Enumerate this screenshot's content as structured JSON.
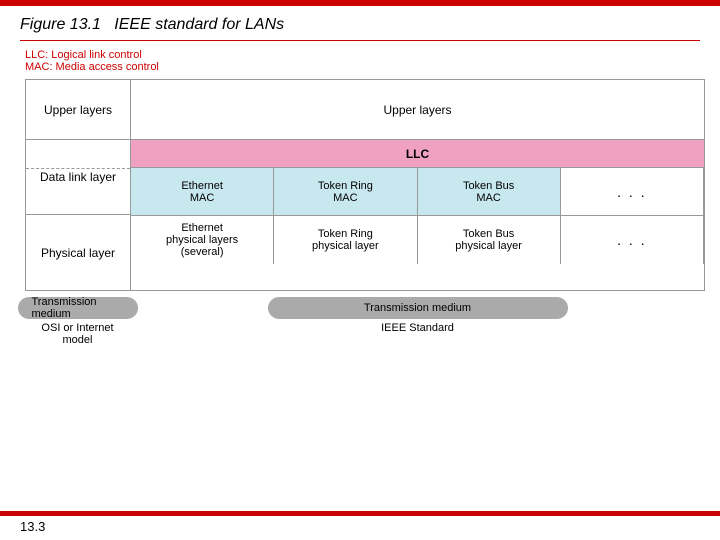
{
  "topBar": {
    "color": "#cc0000"
  },
  "figureTitle": {
    "prefix": "Figure 13.1",
    "subtitle": "IEEE standard for LANs"
  },
  "legend": {
    "llc": "LLC: Logical link control",
    "mac": "MAC: Media access control"
  },
  "osi": {
    "upperLabel": "Upper layers",
    "dataLinkLabel": "Data link layer",
    "physicalLabel": "Physical layer"
  },
  "ieee": {
    "upperLabel": "Upper layers",
    "llcLabel": "LLC",
    "macCells": [
      "Ethernet\nMAC",
      "Token Ring\nMAC",
      "Token Bus\nMAC",
      "..."
    ],
    "physCells": [
      "Ethernet\nphysical layers\n(several)",
      "Token Ring\nphysical layer",
      "Token Bus\nphysical layer",
      "..."
    ]
  },
  "transmission": {
    "leftLabel": "Transmission medium",
    "rightLabel": "Transmission medium"
  },
  "bottomLabels": {
    "left": "OSI or Internet model",
    "right": "IEEE Standard"
  },
  "pageNumber": "13.3"
}
